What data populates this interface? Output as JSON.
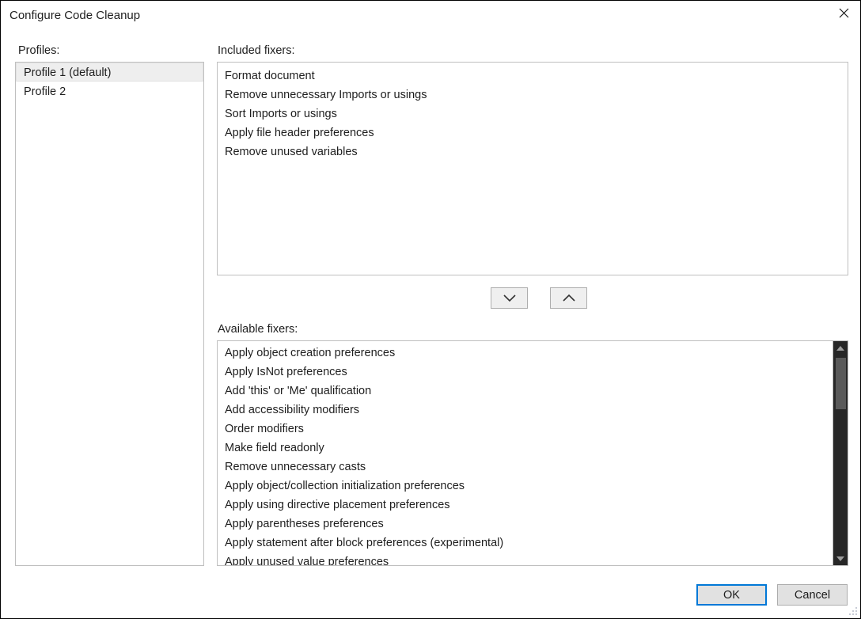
{
  "window": {
    "title": "Configure Code Cleanup",
    "close_icon": "close-icon"
  },
  "profiles": {
    "label": "Profiles:",
    "items": [
      {
        "label": "Profile 1 (default)",
        "selected": true
      },
      {
        "label": "Profile 2",
        "selected": false
      }
    ]
  },
  "included_fixers": {
    "label": "Included fixers:",
    "items": [
      "Format document",
      "Remove unnecessary Imports or usings",
      "Sort Imports or usings",
      "Apply file header preferences",
      "Remove unused variables"
    ]
  },
  "move_buttons": {
    "down": {
      "name": "move-down-button",
      "icon": "chevron-down-icon"
    },
    "up": {
      "name": "move-up-button",
      "icon": "chevron-up-icon"
    }
  },
  "available_fixers": {
    "label": "Available fixers:",
    "items": [
      "Apply object creation preferences",
      "Apply IsNot preferences",
      "Add 'this' or 'Me' qualification",
      "Add accessibility modifiers",
      "Order modifiers",
      "Make field readonly",
      "Remove unnecessary casts",
      "Apply object/collection initialization preferences",
      "Apply using directive placement preferences",
      "Apply parentheses preferences",
      "Apply statement after block preferences (experimental)",
      "Apply unused value preferences"
    ],
    "scrollbar": {
      "up_arrow_icon": "scroll-up-arrow-icon",
      "down_arrow_icon": "scroll-down-arrow-icon",
      "thumb": "scrollbar-thumb"
    }
  },
  "footer": {
    "ok_label": "OK",
    "cancel_label": "Cancel"
  },
  "colors": {
    "accent": "#0078d7",
    "dialog_background": "#ffffff",
    "text": "#1e1e1e",
    "listbox_border": "#bfbfbf",
    "selected_row": "#eeeeee",
    "button_face": "#e1e1e1",
    "scrollbar_track": "#272727",
    "scrollbar_thumb": "#5a5a5a"
  }
}
